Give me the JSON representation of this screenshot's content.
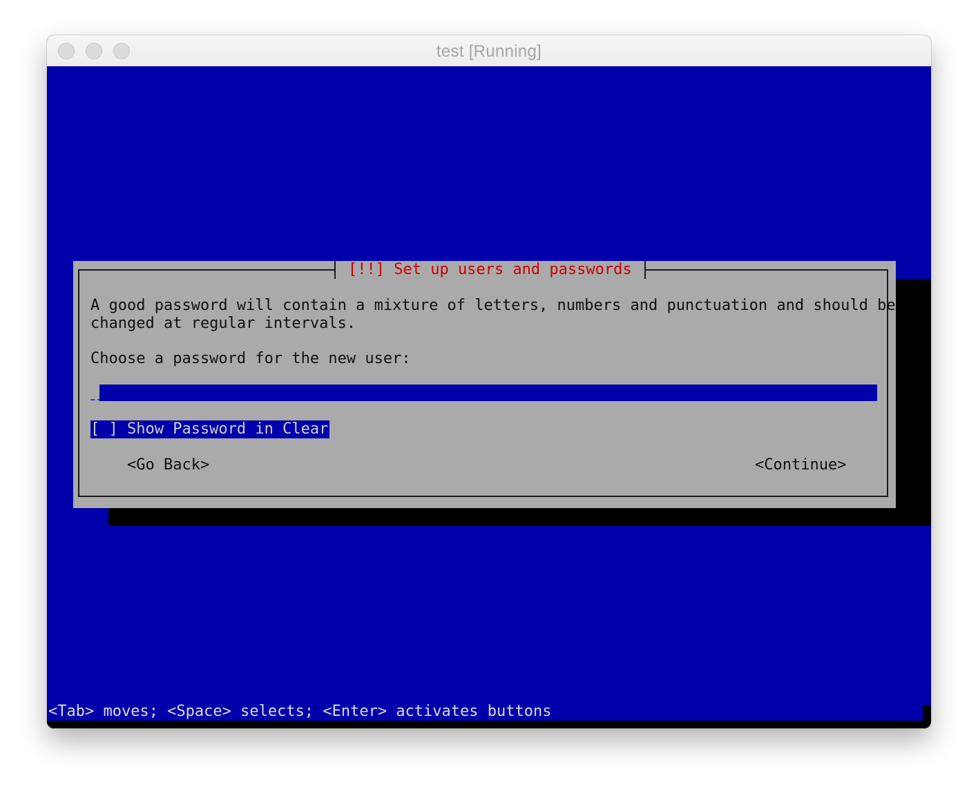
{
  "window": {
    "title": "test [Running]"
  },
  "dialog": {
    "title": "[!!] Set up users and passwords",
    "description_line1": "A good password will contain a mixture of letters, numbers and punctuation and should be",
    "description_line2": "changed at regular intervals.",
    "prompt": "Choose a password for the new user:",
    "password_value": "",
    "show_password_checkbox": "[ ] Show Password in Clear",
    "go_back_label": "<Go Back>",
    "continue_label": "<Continue>"
  },
  "footer": {
    "hint": "<Tab> moves; <Space> selects; <Enter> activates buttons"
  },
  "colors": {
    "screen_background": "#0000aa",
    "dialog_background": "#aaaaaa",
    "title_text": "#cc0000"
  }
}
